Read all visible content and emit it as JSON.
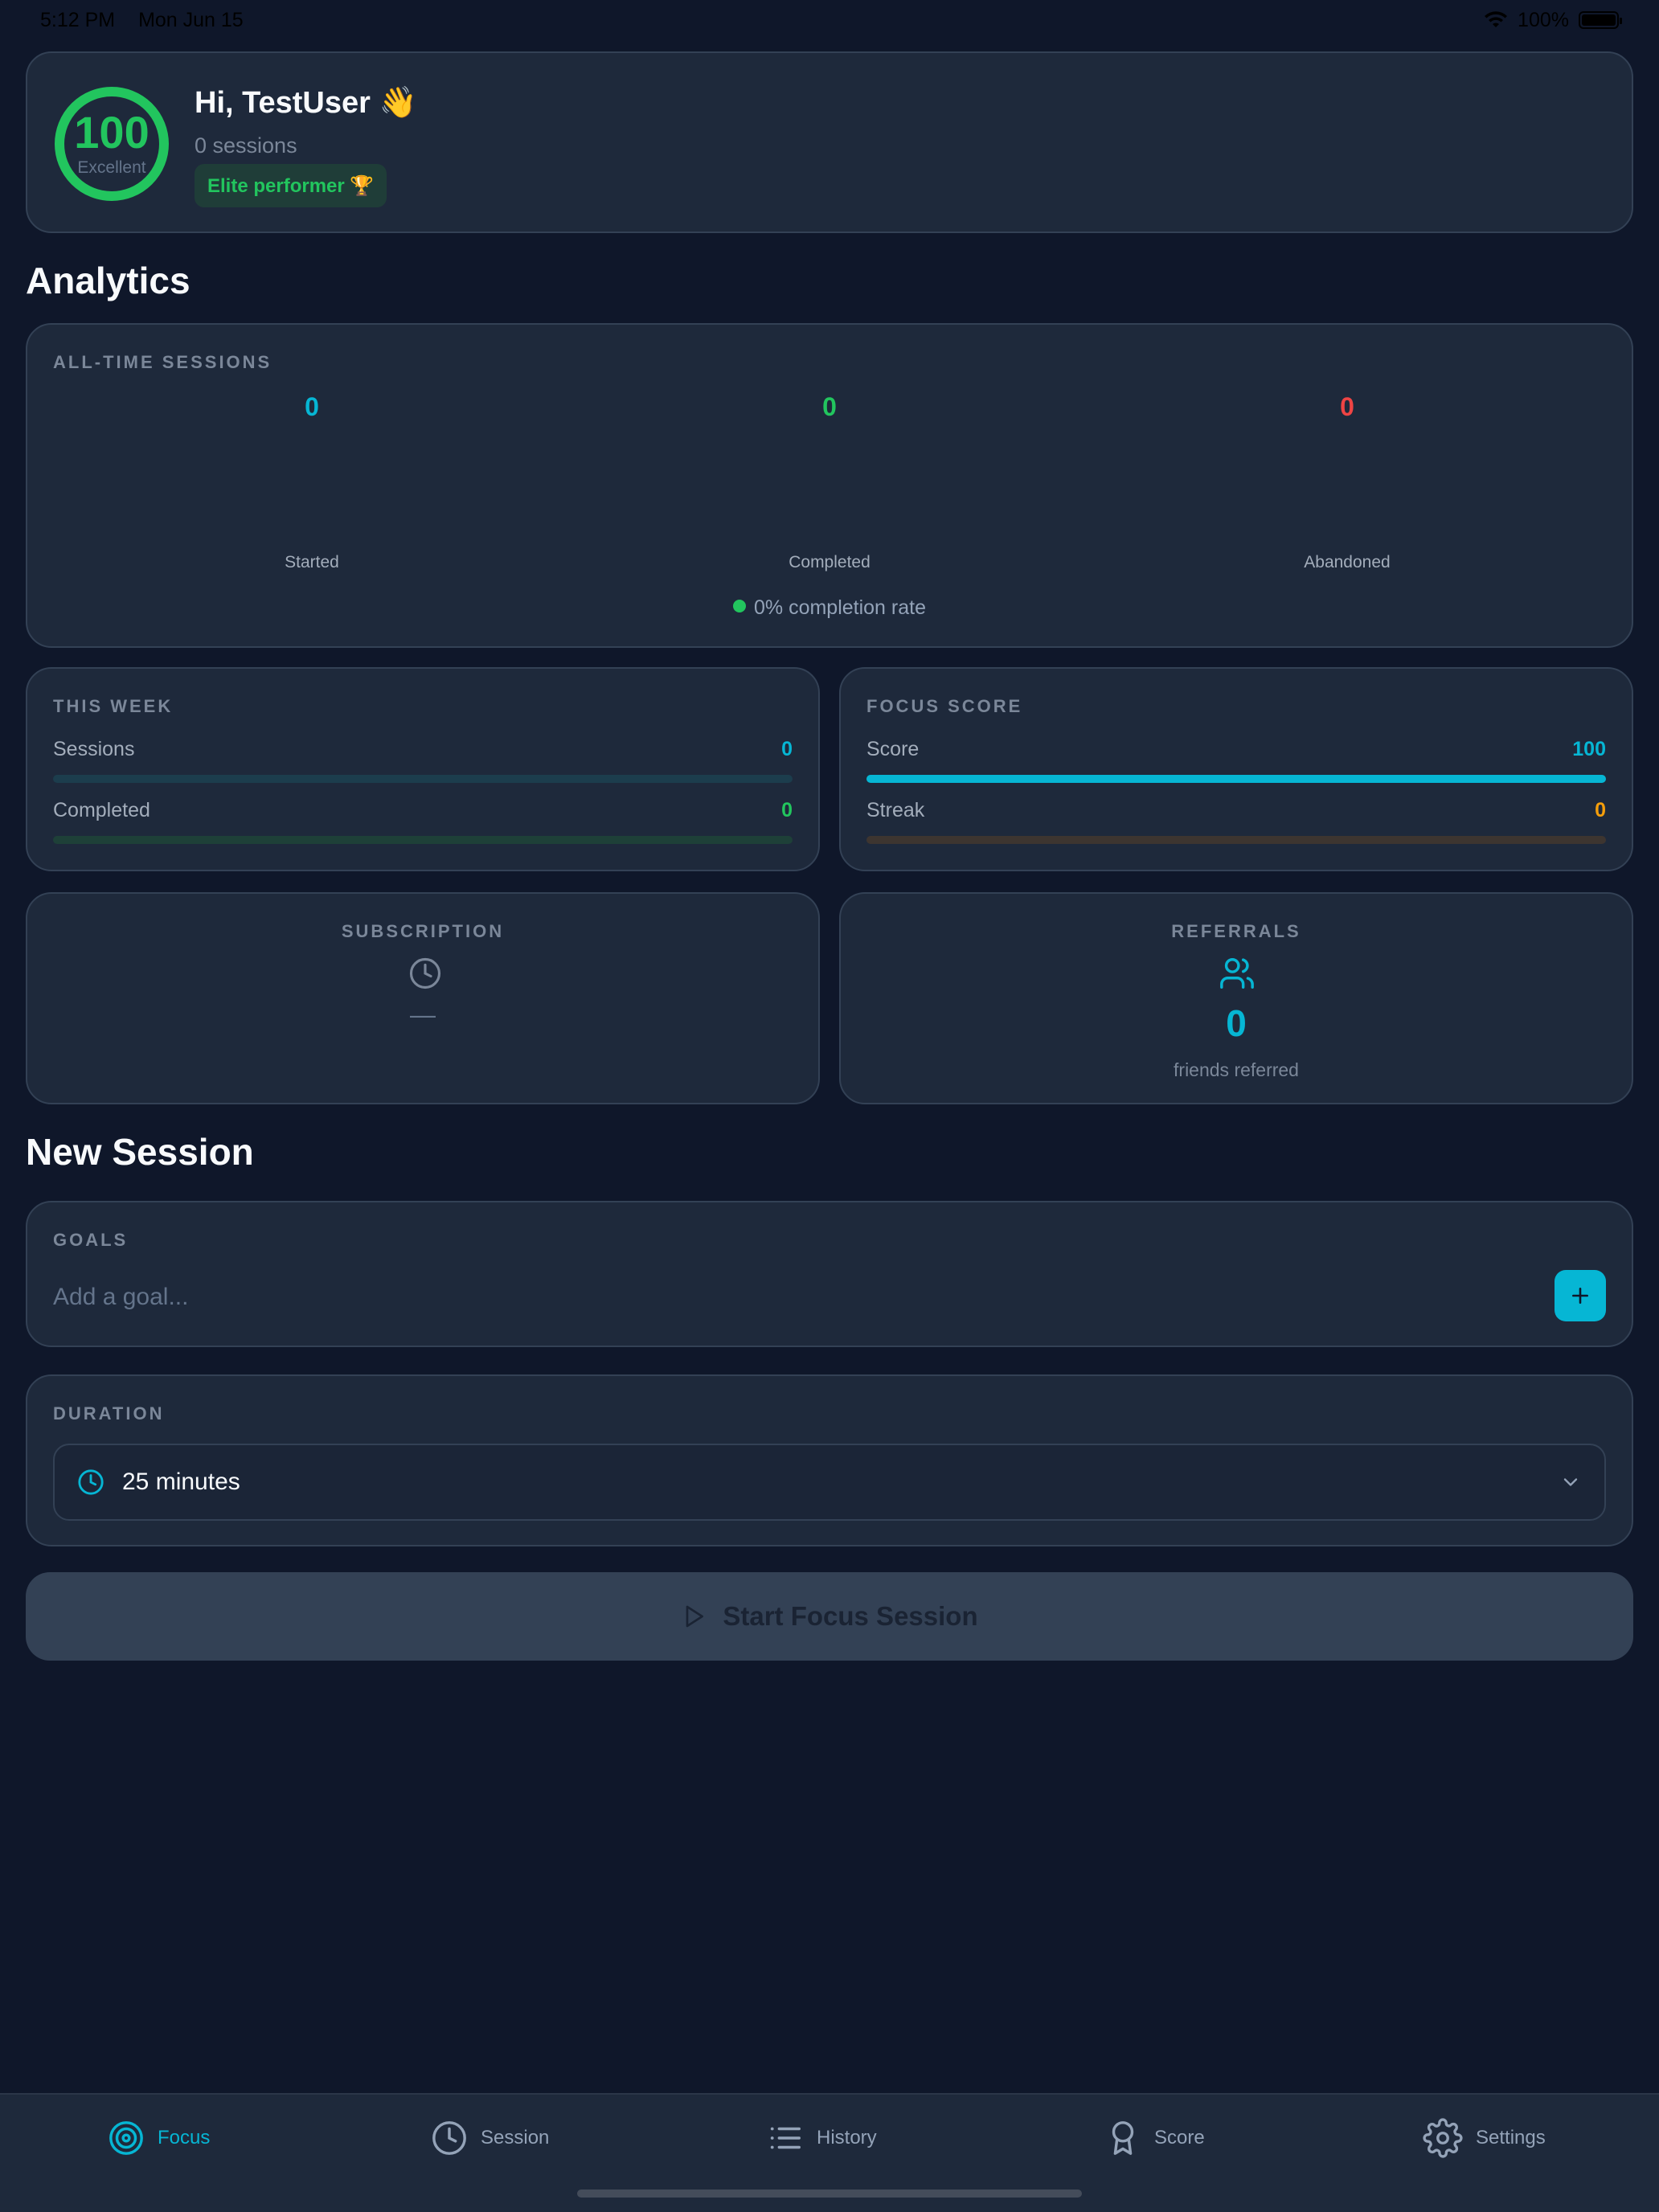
{
  "status_bar": {
    "time": "5:12 PM",
    "date": "Mon Jun 15",
    "battery": "100%"
  },
  "profile": {
    "score": "100",
    "score_label": "Excellent",
    "greeting": "Hi, TestUser 👋",
    "sessions": "0 sessions",
    "badge": "Elite performer 🏆"
  },
  "analytics": {
    "title": "Analytics",
    "all_time": {
      "label": "ALL-TIME SESSIONS",
      "started": {
        "value": "0",
        "label": "Started"
      },
      "completed": {
        "value": "0",
        "label": "Completed"
      },
      "abandoned": {
        "value": "0",
        "label": "Abandoned"
      },
      "completion_rate": "0% completion rate"
    },
    "this_week": {
      "label": "THIS WEEK",
      "sessions_label": "Sessions",
      "sessions_value": "0",
      "sessions_progress": 0,
      "completed_label": "Completed",
      "completed_value": "0",
      "completed_progress": 0
    },
    "focus_score": {
      "label": "FOCUS SCORE",
      "score_label": "Score",
      "score_value": "100",
      "score_progress": 1.0,
      "streak_label": "Streak",
      "streak_value": "0",
      "streak_progress": 0
    },
    "subscription": {
      "label": "SUBSCRIPTION",
      "value": "—"
    },
    "referrals": {
      "label": "REFERRALS",
      "value": "0",
      "caption": "friends referred"
    }
  },
  "new_session": {
    "title": "New Session",
    "goals_label": "GOALS",
    "goal_placeholder": "Add a goal...",
    "duration_label": "DURATION",
    "duration_value": "25 minutes",
    "start_label": "Start Focus Session"
  },
  "tabs": [
    {
      "label": "Focus",
      "icon": "target-icon",
      "active": true
    },
    {
      "label": "Session",
      "icon": "clock-icon",
      "active": false
    },
    {
      "label": "History",
      "icon": "list-icon",
      "active": false
    },
    {
      "label": "Score",
      "icon": "award-icon",
      "active": false
    },
    {
      "label": "Settings",
      "icon": "gear-icon",
      "active": false
    }
  ],
  "colors": {
    "background": "#0f172a",
    "card": "#1e293b",
    "accent_cyan": "#06b6d4",
    "success_green": "#22c55e",
    "danger_red": "#ef4444",
    "warning_amber": "#f59e0b"
  }
}
